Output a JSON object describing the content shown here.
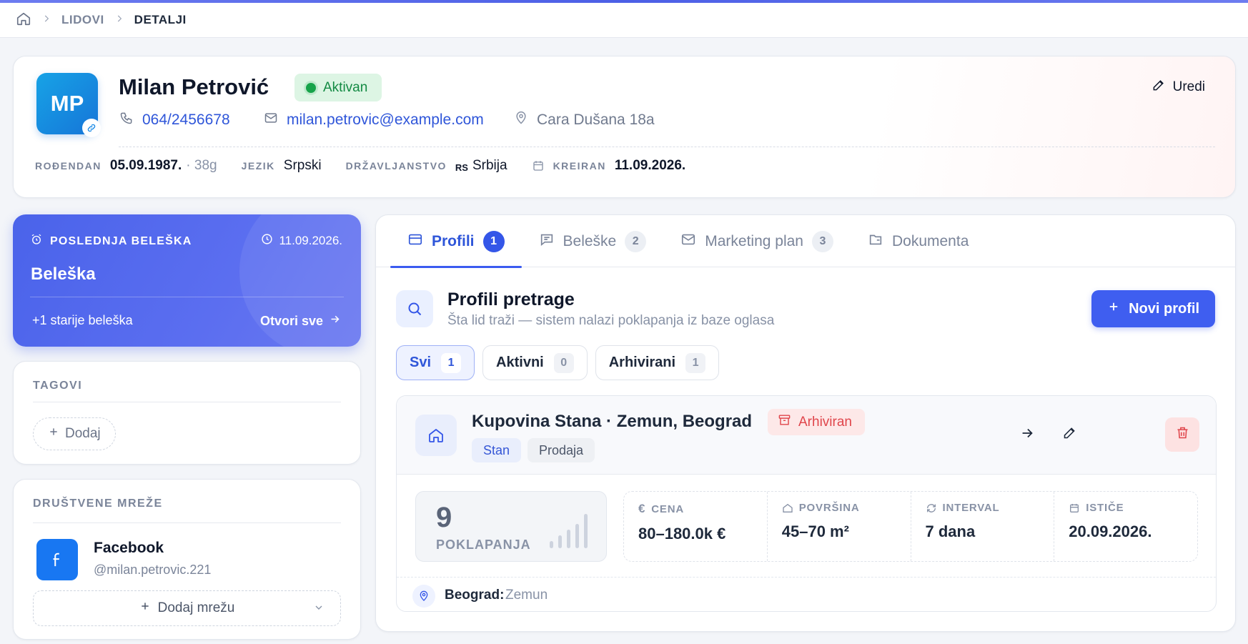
{
  "breadcrumb": {
    "items": [
      "LIDOVI",
      "DETALJI"
    ]
  },
  "lead": {
    "initials": "MP",
    "name": "Milan Petrović",
    "status": "Aktivan",
    "phone": "064/2456678",
    "email": "milan.petrovic@example.com",
    "address": "Cara Dušana 18a",
    "edit_label": "Uredi",
    "birthday_label": "ROĐENDAN",
    "birthday": "05.09.1987.",
    "age": "· 38g",
    "language_label": "JEZIK",
    "language": "Srpski",
    "citizenship_label": "DRŽAVLJANSTVO",
    "citizenship_code": "RS",
    "citizenship": "Srbija",
    "created_label": "KREIRAN",
    "created": "11.09.2026."
  },
  "note": {
    "title": "POSLEDNJA BELEŠKA",
    "date": "11.09.2026.",
    "body": "Beleška",
    "more": "+1 starije beleška",
    "open_all": "Otvori sve"
  },
  "tags": {
    "title": "TAGOVI",
    "add_label": "Dodaj"
  },
  "social": {
    "title": "DRUŠTVENE MREŽE",
    "network": "Facebook",
    "handle": "@milan.petrovic.221",
    "add_label": "Dodaj mrežu"
  },
  "tabs": [
    {
      "label": "Profili",
      "count": "1"
    },
    {
      "label": "Beleške",
      "count": "2"
    },
    {
      "label": "Marketing plan",
      "count": "3"
    },
    {
      "label": "Dokumenta",
      "count": ""
    }
  ],
  "profiles": {
    "title": "Profili pretrage",
    "subtitle": "Šta lid traži — sistem nalazi poklapanja iz baze oglasa",
    "new_button": "Novi profil",
    "filters": [
      {
        "label": "Svi",
        "count": "1"
      },
      {
        "label": "Aktivni",
        "count": "0"
      },
      {
        "label": "Arhivirani",
        "count": "1"
      }
    ],
    "item": {
      "title": "Kupovina Stana · Zemun, Beograd",
      "badge": "Arhiviran",
      "tag1": "Stan",
      "tag2": "Prodaja",
      "matches": "9",
      "matches_label": "POKLAPANJA",
      "stats": [
        {
          "label": "CENA",
          "value": "80–180.0k €"
        },
        {
          "label": "POVRŠINA",
          "value": "45–70 m²"
        },
        {
          "label": "INTERVAL",
          "value": "7 dana"
        },
        {
          "label": "ISTIČE",
          "value": "20.09.2026."
        }
      ],
      "city": "Beograd:",
      "area": "Zemun"
    }
  },
  "colors": {
    "accent": "#3f5ef0",
    "active_green": "#17a34a",
    "archived_red": "#e0454b",
    "facebook": "#1877f2"
  }
}
